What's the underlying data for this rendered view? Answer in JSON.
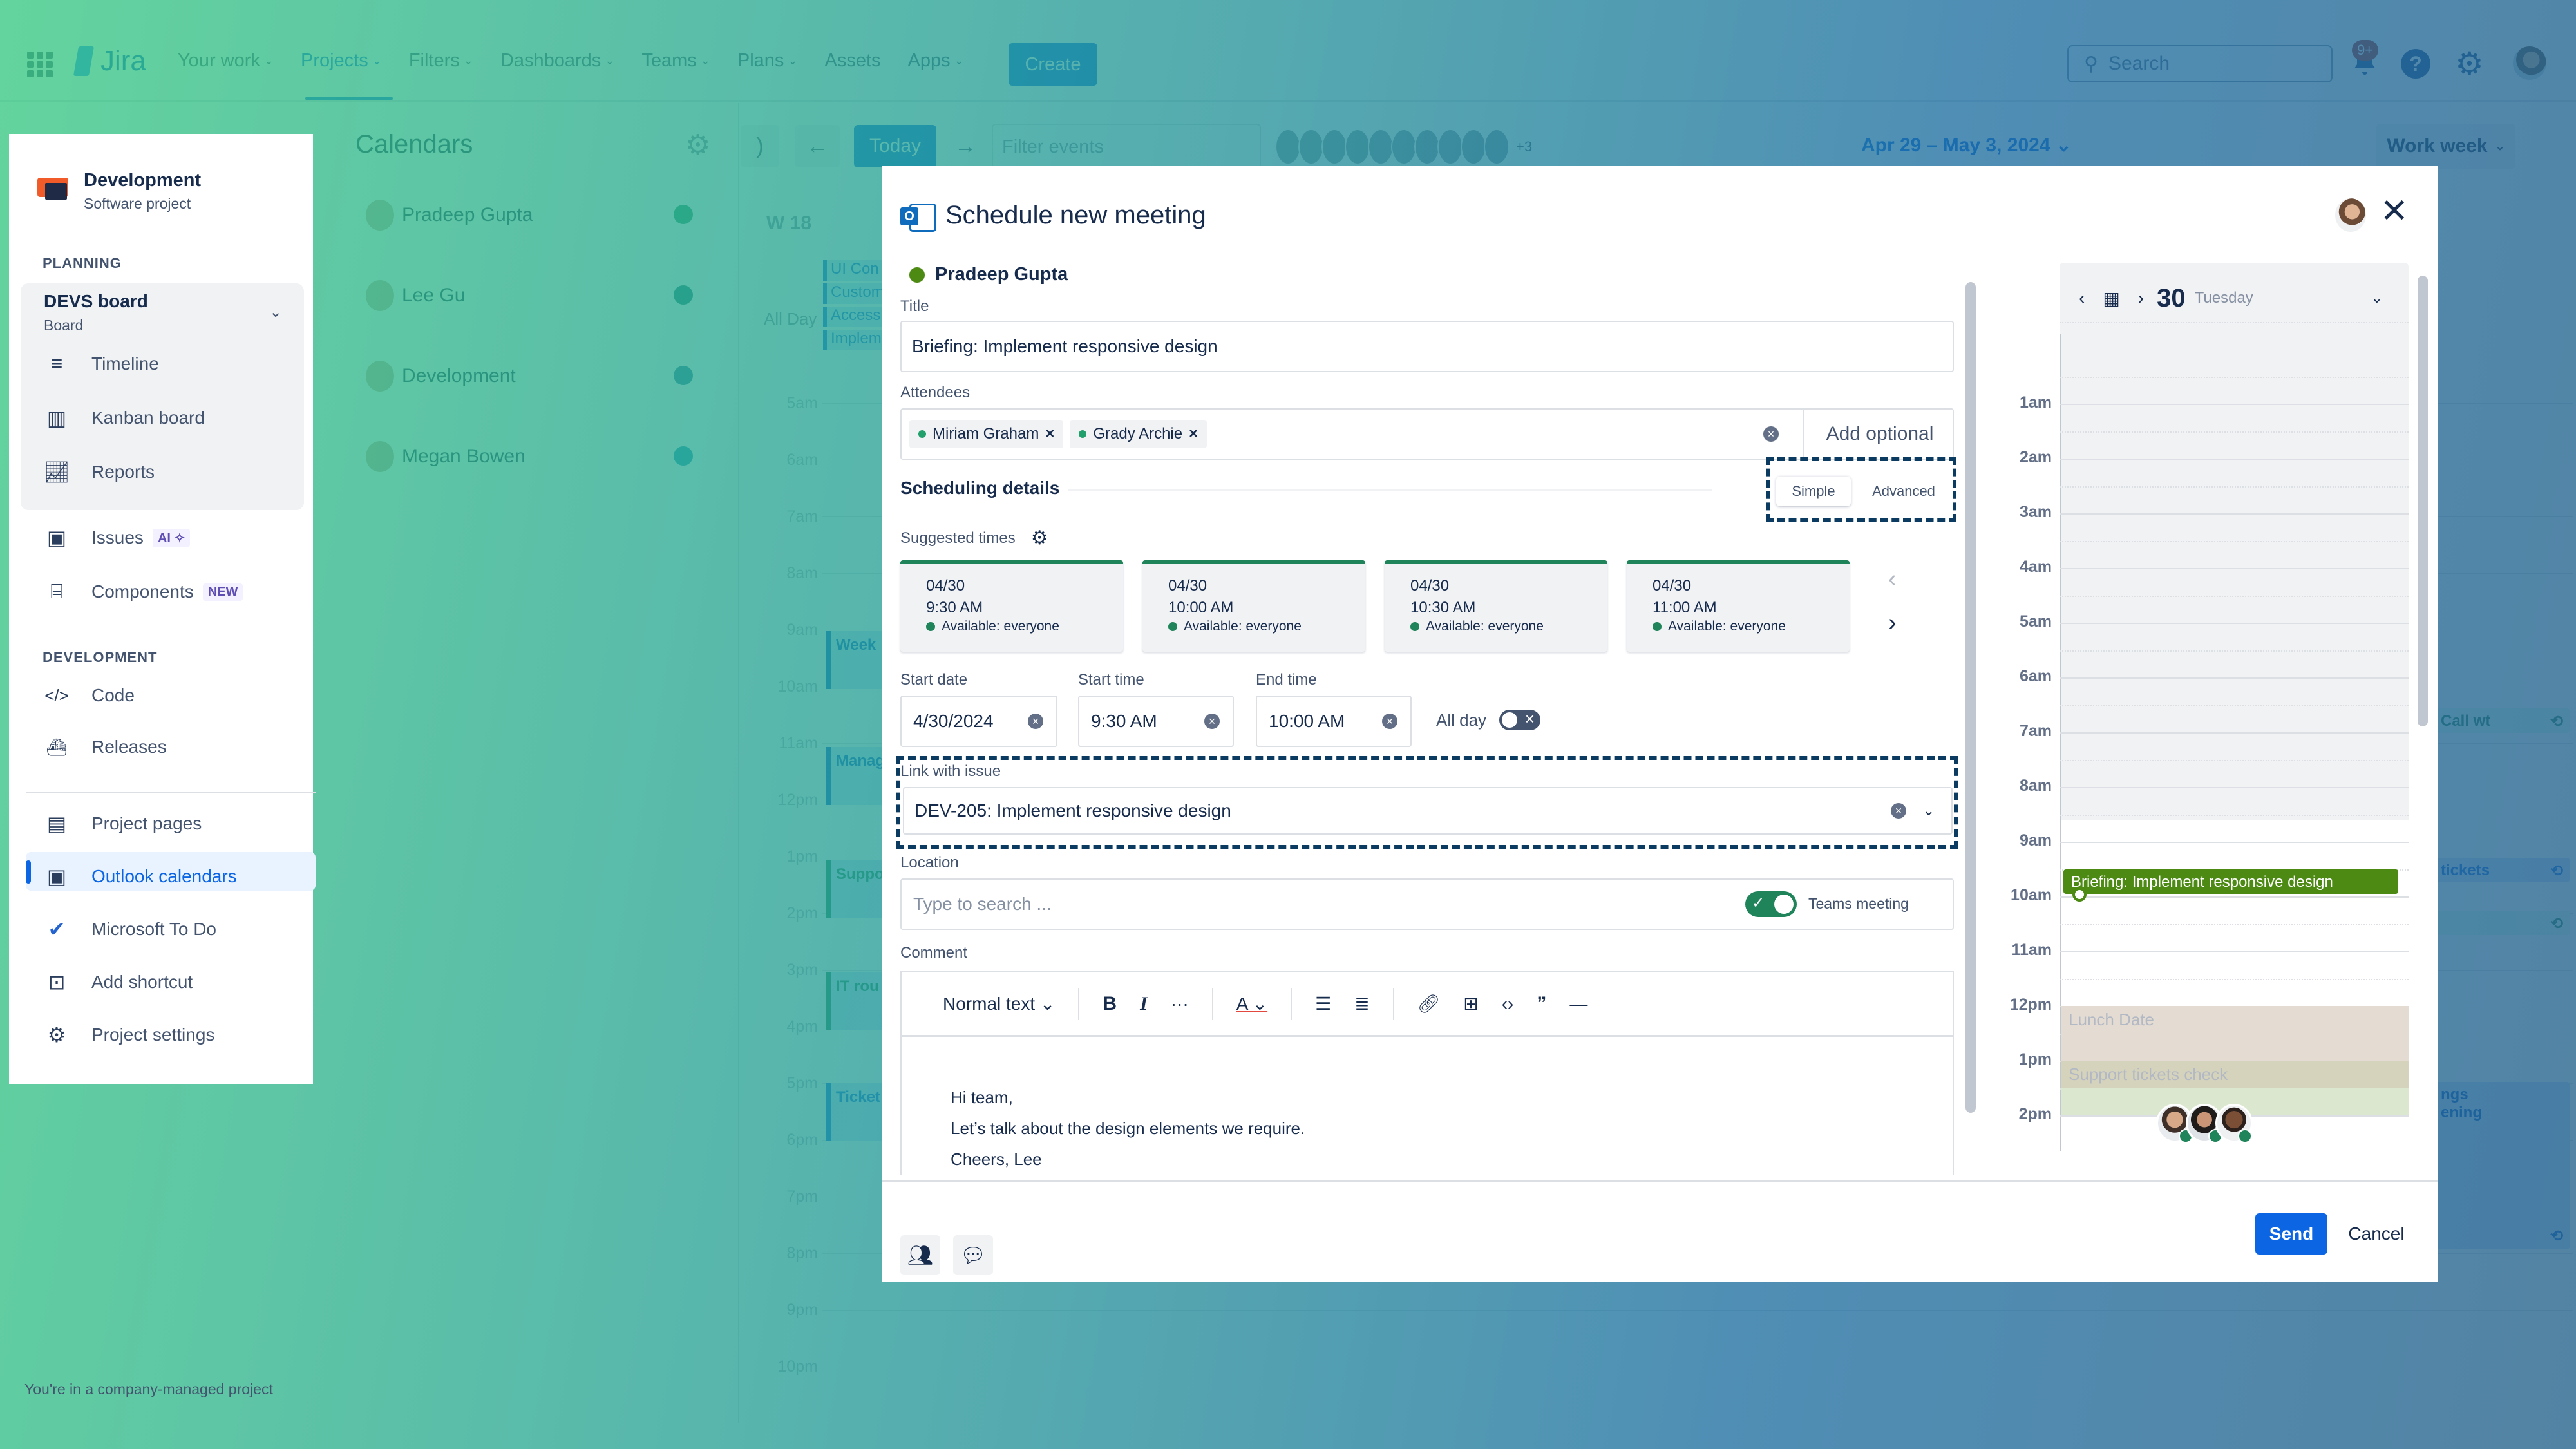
{
  "topnav": {
    "product": "Jira",
    "items": [
      {
        "label": "Your work",
        "dropdown": true
      },
      {
        "label": "Projects",
        "dropdown": true,
        "active": true
      },
      {
        "label": "Filters",
        "dropdown": true
      },
      {
        "label": "Dashboards",
        "dropdown": true
      },
      {
        "label": "Teams",
        "dropdown": true
      },
      {
        "label": "Plans",
        "dropdown": true
      },
      {
        "label": "Assets",
        "dropdown": false
      },
      {
        "label": "Apps",
        "dropdown": true
      }
    ],
    "create_label": "Create",
    "search_placeholder": "Search",
    "notification_badge": "9+",
    "help_glyph": "?"
  },
  "sidebar": {
    "project_name": "Development",
    "project_type": "Software project",
    "planning_label": "PLANNING",
    "board_name": "DEVS board",
    "board_type": "Board",
    "planning_items": [
      {
        "label": "Timeline",
        "icon": "timeline-icon"
      },
      {
        "label": "Kanban board",
        "icon": "kanban-board-icon"
      },
      {
        "label": "Reports",
        "icon": "reports-icon"
      }
    ],
    "issues_label": "Issues",
    "issues_badge": "AI ✧",
    "components_label": "Components",
    "components_badge": "NEW",
    "development_label": "DEVELOPMENT",
    "development_items": [
      {
        "label": "Code",
        "icon": "code-icon"
      },
      {
        "label": "Releases",
        "icon": "releases-icon"
      }
    ],
    "extra_items": [
      {
        "label": "Project pages",
        "icon": "project-pages-icon",
        "active": false
      },
      {
        "label": "Outlook calendars",
        "icon": "outlook-calendar-icon",
        "active": true
      },
      {
        "label": "Microsoft To Do",
        "icon": "microsoft-todo-icon",
        "active": false
      },
      {
        "label": "Add shortcut",
        "icon": "add-shortcut-icon",
        "active": false
      },
      {
        "label": "Project settings",
        "icon": "settings-icon",
        "active": false
      }
    ],
    "footer_note": "You're in a company-managed project"
  },
  "calendars": {
    "title": "Calendars",
    "items": [
      {
        "name": "Pradeep Gupta",
        "color": "#22a06b"
      },
      {
        "name": "Lee Gu",
        "color": "#1b7f79"
      },
      {
        "name": "Development",
        "color": "#2a7f9e"
      },
      {
        "name": "Megan Bowen",
        "color": "#1d9bc0"
      }
    ]
  },
  "week_view": {
    "today_label": "Today",
    "filter_placeholder": "Filter events",
    "more_avatars": "+3",
    "date_range": "Apr 29 – May 3, 2024",
    "view_mode": "Work week",
    "week_label": "W 18",
    "all_day_label": "All Day",
    "all_day_events": [
      "UI Con",
      "Custom",
      "Access",
      "Implem"
    ],
    "hours": [
      "5am",
      "6am",
      "7am",
      "8am",
      "9am",
      "10am",
      "11am",
      "12pm",
      "1pm",
      "2pm",
      "3pm",
      "4pm",
      "5pm",
      "6pm",
      "7pm",
      "8pm",
      "9pm",
      "10pm"
    ],
    "events": [
      "Week",
      "Manag",
      "Suppo",
      "IT rou",
      "Ticket"
    ],
    "right_events": [
      "Call wt",
      "tickets",
      "",
      "ngs\nening"
    ]
  },
  "modal": {
    "title": "Schedule new meeting",
    "organizer": "Pradeep Gupta",
    "title_label": "Title",
    "title_value": "Briefing: Implement responsive design",
    "attendees_label": "Attendees",
    "attendees": [
      "Miriam Graham",
      "Grady Archie"
    ],
    "add_optional_label": "Add optional",
    "scheduling_label": "Scheduling details",
    "mode_simple": "Simple",
    "mode_advanced": "Advanced",
    "suggested_label": "Suggested times",
    "suggested_times": [
      {
        "date": "04/30",
        "time": "9:30 AM",
        "availability": "Available: everyone"
      },
      {
        "date": "04/30",
        "time": "10:00 AM",
        "availability": "Available: everyone"
      },
      {
        "date": "04/30",
        "time": "10:30 AM",
        "availability": "Available: everyone"
      },
      {
        "date": "04/30",
        "time": "11:00 AM",
        "availability": "Available: everyone"
      }
    ],
    "start_date_label": "Start date",
    "start_date": "4/30/2024",
    "start_time_label": "Start time",
    "start_time": "9:30 AM",
    "end_time_label": "End time",
    "end_time": "10:00 AM",
    "all_day_label": "All day",
    "all_day": false,
    "link_issue_label": "Link with issue",
    "link_issue_value": "DEV-205: Implement responsive design",
    "location_label": "Location",
    "location_placeholder": "Type to search ...",
    "teams_meeting_label": "Teams meeting",
    "teams_meeting": true,
    "comment_label": "Comment",
    "text_style": "Normal text",
    "comment_lines": [
      "Hi team,",
      "Let’s talk about the design elements we require.",
      "Cheers, Lee"
    ],
    "send_label": "Send",
    "cancel_label": "Cancel"
  },
  "agenda": {
    "day_number": "30",
    "day_name": "Tuesday",
    "hours": [
      "1am",
      "2am",
      "3am",
      "4am",
      "5am",
      "6am",
      "7am",
      "8am",
      "9am",
      "10am",
      "11am",
      "12pm",
      "1pm",
      "2pm"
    ],
    "events": [
      {
        "title": "Briefing: Implement responsive design",
        "start": "9:30",
        "end": "10:00",
        "color": "#4c8a14"
      },
      {
        "title": "Lunch Date",
        "start": "12:00",
        "end": "13:00",
        "color": "#e4dcd2"
      },
      {
        "title": "Support tickets check",
        "start": "13:00",
        "end": "13:30",
        "color": "#d6d3bc"
      },
      {
        "title": "",
        "start": "13:30",
        "end": "14:00",
        "color": "#dce7d0"
      }
    ]
  }
}
